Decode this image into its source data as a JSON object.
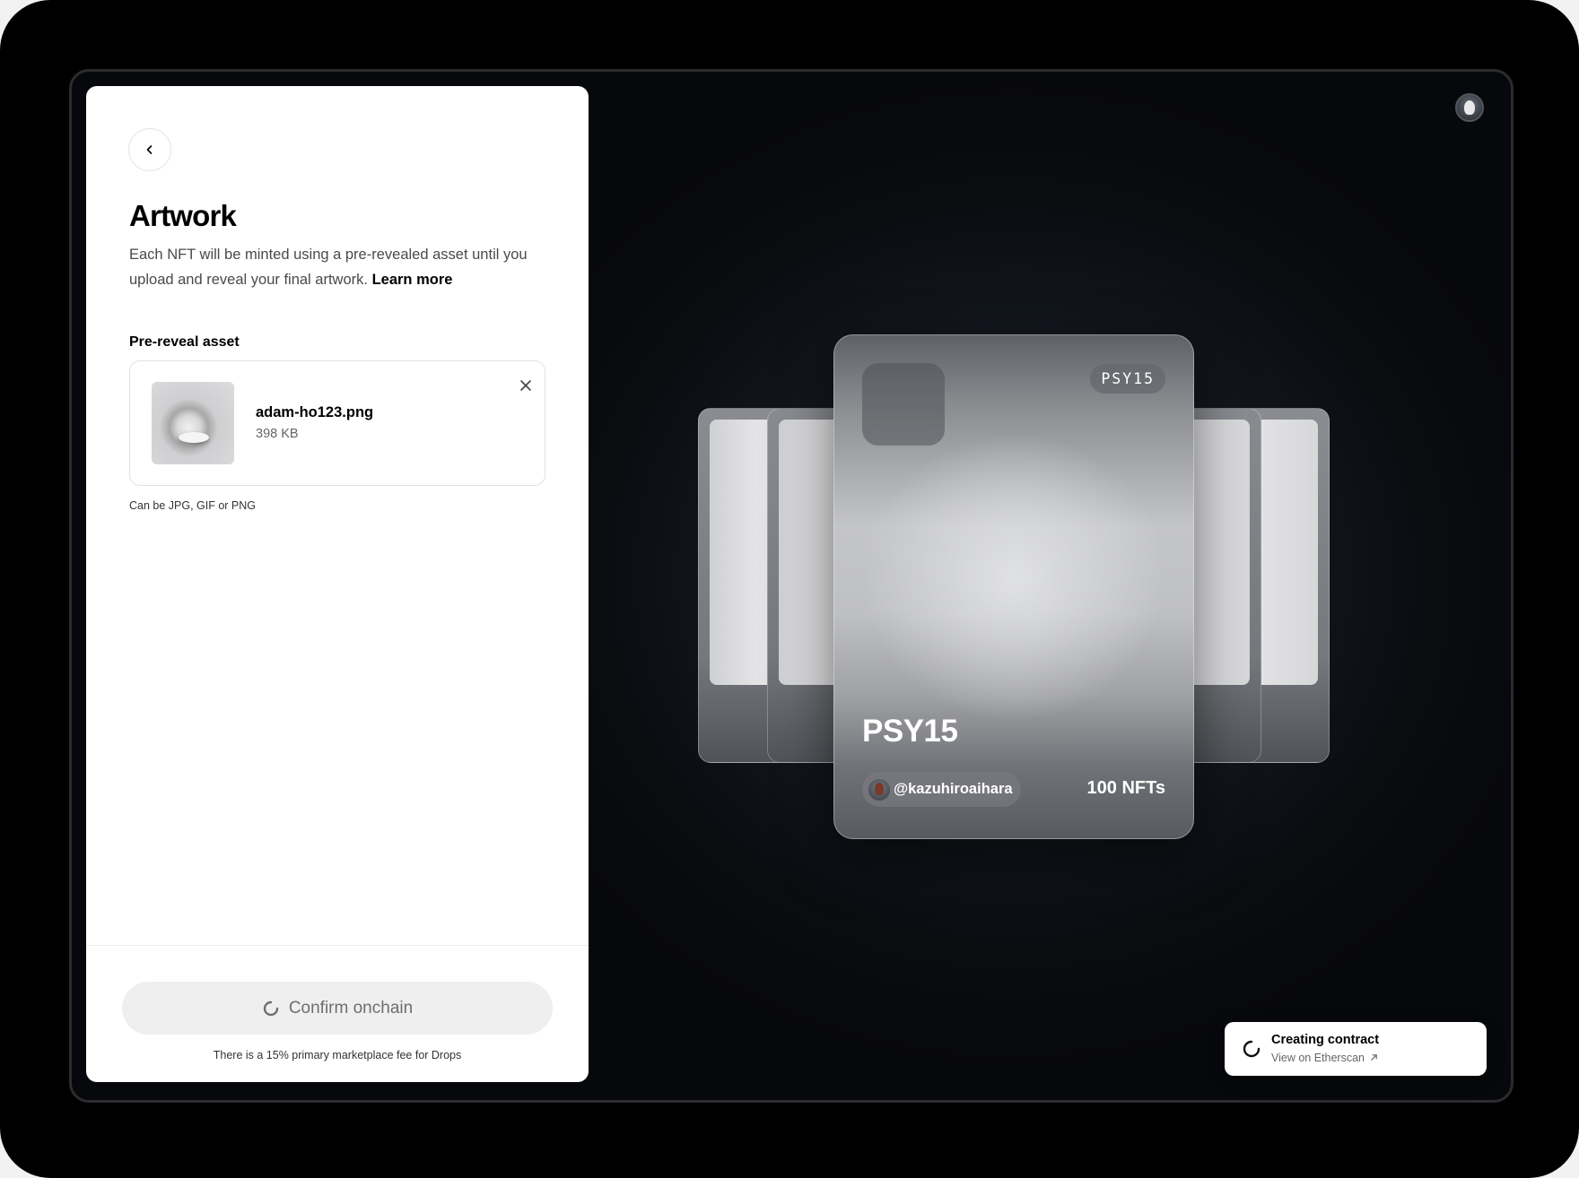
{
  "panel": {
    "title": "Artwork",
    "description": "Each NFT will be minted using a pre-revealed asset until you upload and reveal your final artwork.",
    "learn_more": "Learn more",
    "section_label": "Pre-reveal asset",
    "file": {
      "name": "adam-ho123.png",
      "size": "398 KB"
    },
    "hint": "Can be JPG, GIF or PNG",
    "confirm_label": "Confirm onchain",
    "fee_note": "There is a 15% primary marketplace fee for Drops"
  },
  "preview": {
    "tag": "PSY15",
    "title": "PSY15",
    "creator": "@kazuhiroaihara",
    "count": "100 NFTs"
  },
  "toast": {
    "title": "Creating contract",
    "link": "View on Etherscan"
  },
  "icons": {
    "back": "chevron-left-icon",
    "close": "close-icon",
    "spinner": "spinner-icon",
    "external": "arrow-up-right-icon"
  }
}
